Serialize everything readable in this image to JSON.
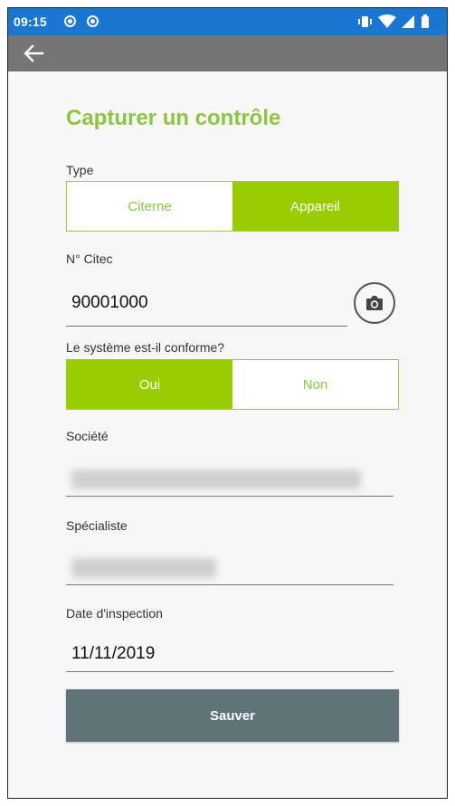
{
  "status_bar": {
    "time": "09:15",
    "icons": [
      "chrome-icon",
      "chrome-icon",
      "vibrate-icon",
      "wifi-icon",
      "signal-icon",
      "battery-icon"
    ]
  },
  "app_bar": {
    "back_icon": "arrow-left-icon"
  },
  "form": {
    "title": "Capturer un contrôle",
    "type": {
      "label": "Type",
      "options": [
        "Citerne",
        "Appareil"
      ],
      "selected": "Appareil"
    },
    "citec": {
      "label": "N° Citec",
      "value": "90001000",
      "camera_icon": "camera-icon"
    },
    "conform": {
      "label": "Le système est-il conforme?",
      "options": [
        "Oui",
        "Non"
      ],
      "selected": "Oui"
    },
    "societe": {
      "label": "Société"
    },
    "specialiste": {
      "label": "Spécialiste"
    },
    "date": {
      "label": "Date d'inspection",
      "value": "11/11/2019"
    },
    "save_label": "Sauver"
  },
  "colors": {
    "status_bar": "#1976d2",
    "app_bar": "#757575",
    "accent_green": "#9acd00",
    "title_green": "#8cc63f",
    "save_button": "#5f7378",
    "background": "#f7f7f7"
  }
}
